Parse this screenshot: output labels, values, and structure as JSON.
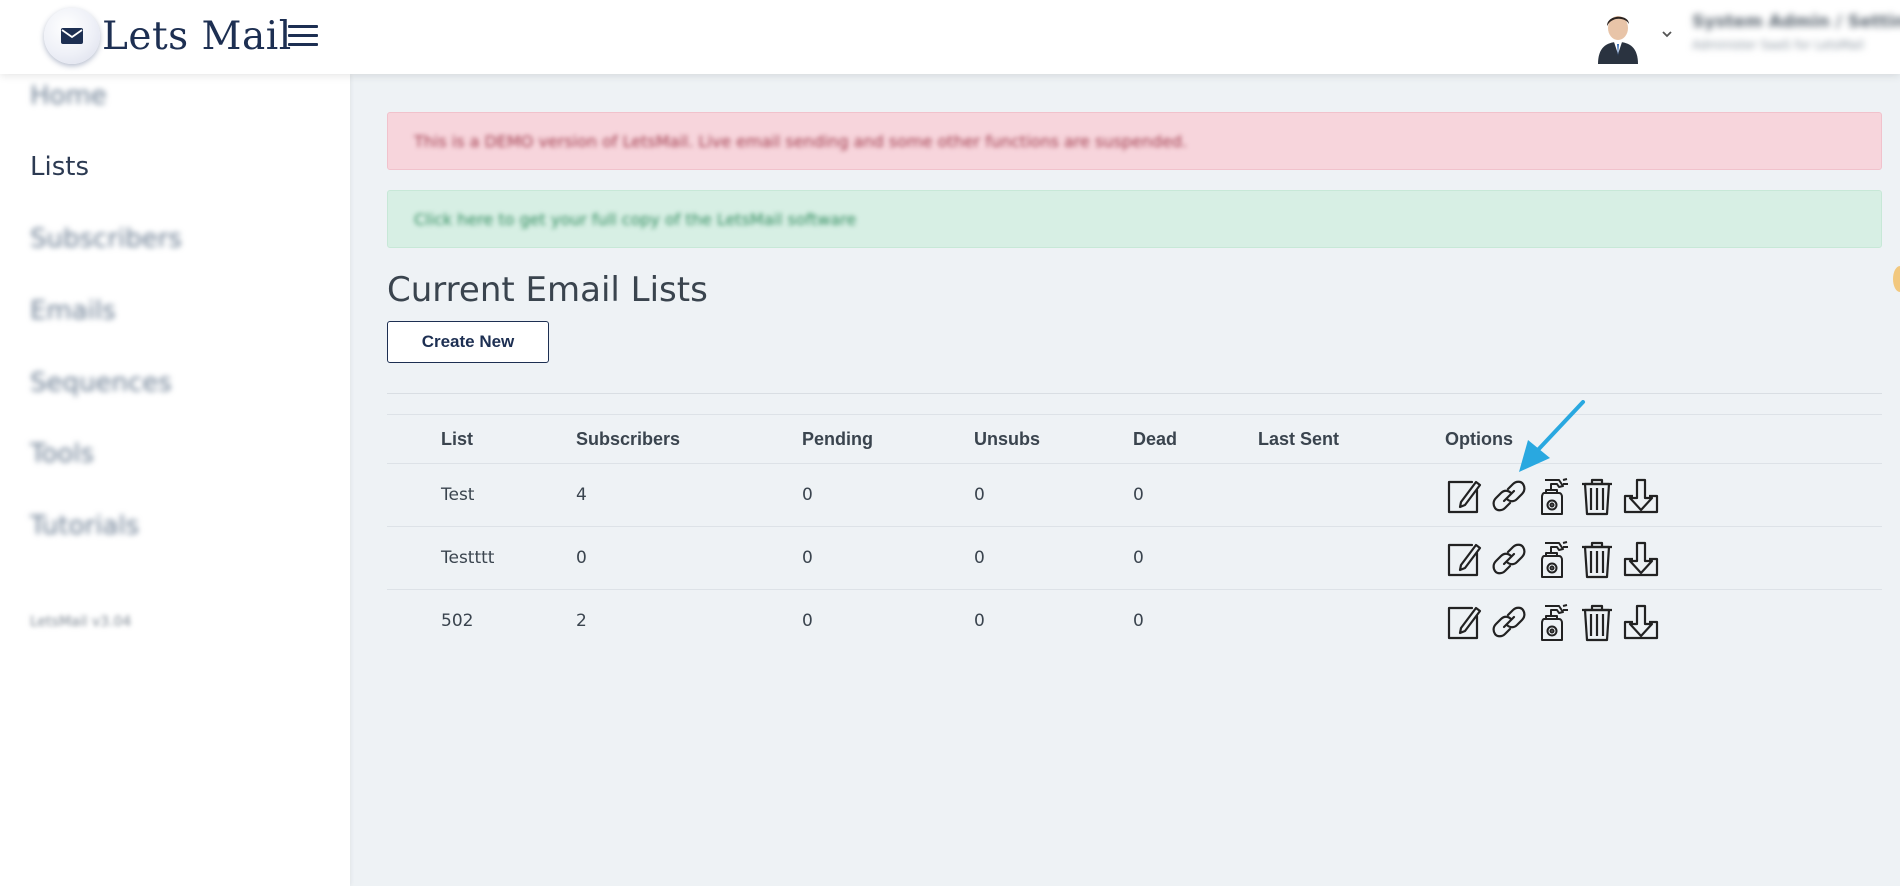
{
  "app": {
    "title": "Lets Mail"
  },
  "header": {
    "user_name": "System Admin / Settings",
    "user_sub": "Administer SaaS for LetsMail"
  },
  "sidebar": {
    "items": [
      {
        "label": "Home"
      },
      {
        "label": "Lists"
      },
      {
        "label": "Subscribers"
      },
      {
        "label": "Emails"
      },
      {
        "label": "Sequences"
      },
      {
        "label": "Tools"
      },
      {
        "label": "Tutorials"
      }
    ],
    "version": "LetsMail v3.04"
  },
  "alerts": {
    "danger": "This is a DEMO version of LetsMail. Live email sending and some other functions are suspended.",
    "success": "Click here to get your full copy of the LetsMail software"
  },
  "main": {
    "title": "Current Email Lists",
    "create_button": "Create New"
  },
  "table": {
    "headers": [
      "List",
      "Subscribers",
      "Pending",
      "Unsubs",
      "Dead",
      "Last Sent",
      "Options"
    ],
    "rows": [
      [
        "Test",
        "4",
        "0",
        "0",
        "0",
        ""
      ],
      [
        "Testttt",
        "0",
        "0",
        "0",
        "0",
        ""
      ],
      [
        "502",
        "2",
        "0",
        "0",
        "0",
        ""
      ]
    ],
    "option_icons": [
      "edit-icon",
      "link-icon",
      "clean-spray-icon",
      "trash-icon",
      "download-icon"
    ]
  },
  "colors": {
    "brand": "#1d2f52",
    "alert_danger_bg": "#f7d5dc",
    "alert_success_bg": "#d7efe4",
    "arrow": "#29a8e0"
  }
}
